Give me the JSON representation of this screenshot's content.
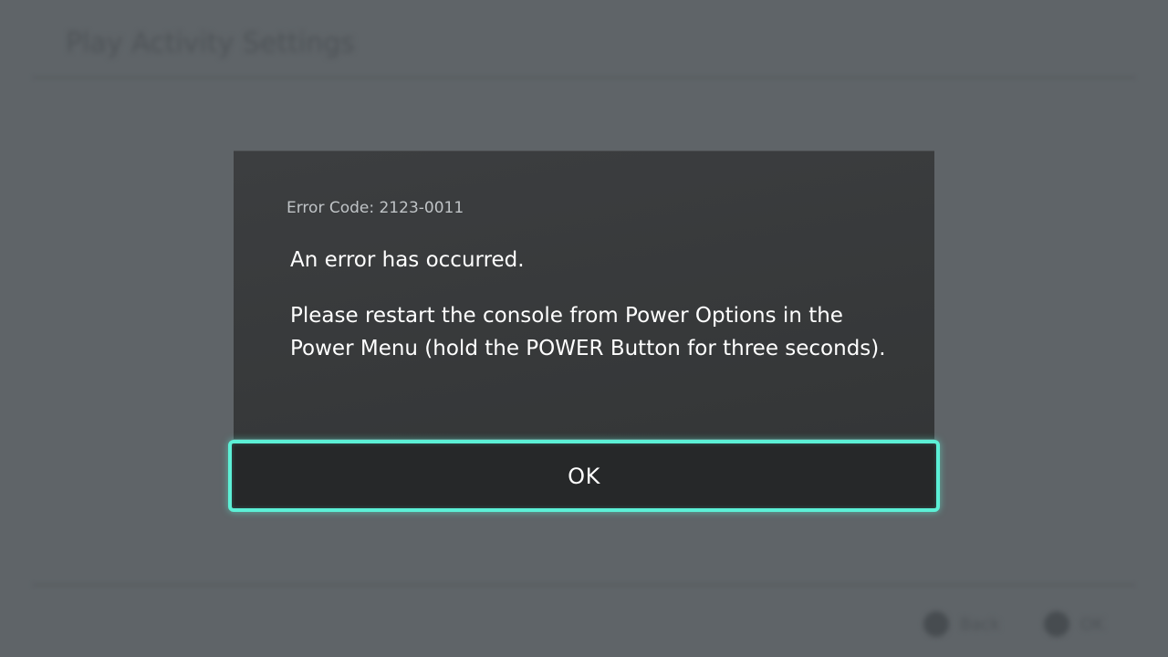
{
  "background": {
    "screen_title": "Play Activity Settings",
    "footer": {
      "back_label": "Back",
      "ok_label": "OK"
    }
  },
  "dialog": {
    "error_code": "Error Code: 2123-0011",
    "heading": "An error has occurred.",
    "message": "Please restart the console from Power Options in the Power Menu (hold the POWER Button for three seconds).",
    "ok_button_label": "OK"
  },
  "colors": {
    "accent": "#5cf0d6",
    "dialog_background": "#393b3d",
    "button_background": "#262829",
    "overlay": "#5d6266"
  },
  "icons": {
    "back_hint": "b-button-icon",
    "ok_hint": "a-button-icon"
  }
}
